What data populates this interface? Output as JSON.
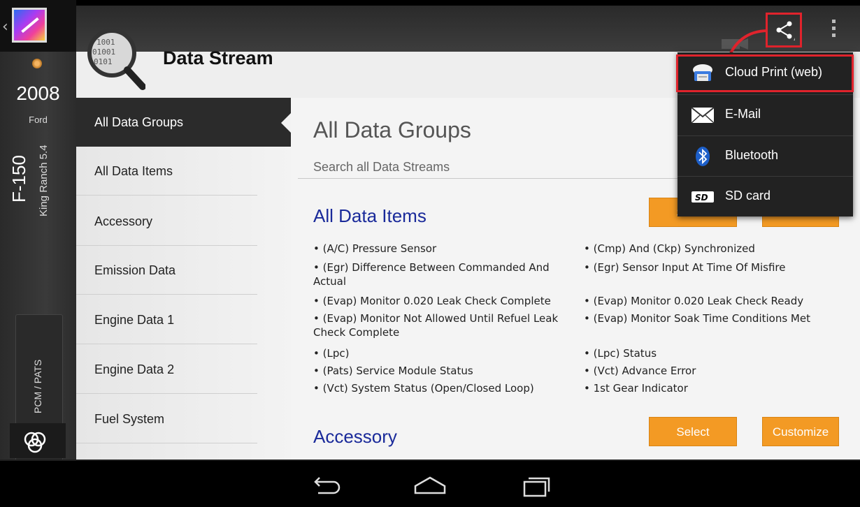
{
  "vehicle": {
    "year": "2008",
    "make": "Ford",
    "model": "F-150",
    "trim": "King Ranch 5.4",
    "module": "PCM / PATS"
  },
  "header": {
    "title": "Data Stream"
  },
  "nav": {
    "items": [
      {
        "label": "All Data Groups",
        "active": true
      },
      {
        "label": "All Data Items"
      },
      {
        "label": "Accessory"
      },
      {
        "label": "Emission Data"
      },
      {
        "label": "Engine Data 1"
      },
      {
        "label": "Engine Data 2"
      },
      {
        "label": "Fuel System"
      }
    ]
  },
  "panel": {
    "title": "All Data Groups",
    "search_placeholder": "Search all Data Streams",
    "sections": [
      {
        "title": "All Data Items",
        "select_label": "Select",
        "customize_label": "Customize",
        "left_items": [
          "• (A/C) Pressure Sensor",
          "• (Egr) Difference Between Commanded And Actual",
          "• (Evap) Monitor 0.020 Leak Check Complete",
          "• (Evap) Monitor Not Allowed Until Refuel Leak Check Complete",
          "• (Lpc)",
          "• (Pats) Service Module Status",
          "• (Vct) System Status (Open/Closed Loop)"
        ],
        "right_items": [
          "• (Cmp) And (Ckp) Synchronized",
          "• (Egr) Sensor Input At Time Of Misfire",
          "• (Evap) Monitor 0.020 Leak Check Ready",
          "• (Evap) Monitor Soak Time Conditions Met",
          "• (Lpc) Status",
          "• (Vct) Advance Error",
          "• 1st Gear Indicator"
        ]
      },
      {
        "title": "Accessory",
        "select_label": "Select",
        "customize_label": "Customize"
      }
    ]
  },
  "share_menu": {
    "items": [
      {
        "label": "Cloud Print (web)",
        "icon": "cloud-print-icon"
      },
      {
        "label": "E-Mail",
        "icon": "envelope-icon"
      },
      {
        "label": "Bluetooth",
        "icon": "bluetooth-icon"
      },
      {
        "label": "SD card",
        "icon": "sd-card-icon"
      }
    ]
  },
  "colors": {
    "accent_orange": "#f39a24",
    "section_blue": "#1a2a9a",
    "highlight_red": "#e0232c"
  }
}
